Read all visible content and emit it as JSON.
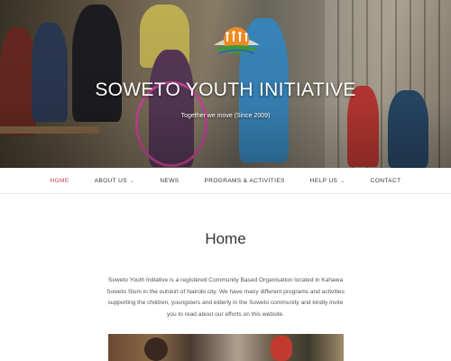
{
  "header": {
    "site_title": "SOWETO YOUTH INITIATIVE",
    "tagline": "Together we move (Since 2009)",
    "logo_icon": "soweto-youth-logo-icon"
  },
  "nav": {
    "items": [
      {
        "label": "HOME",
        "active": true,
        "has_dropdown": false
      },
      {
        "label": "ABOUT US",
        "active": false,
        "has_dropdown": true
      },
      {
        "label": "NEWS",
        "active": false,
        "has_dropdown": false
      },
      {
        "label": "PROGRAMS & ACTIVITIES",
        "active": false,
        "has_dropdown": false
      },
      {
        "label": "HELP US",
        "active": false,
        "has_dropdown": true
      },
      {
        "label": "CONTACT",
        "active": false,
        "has_dropdown": false
      }
    ],
    "dropdown_icon": "chevron-down-icon",
    "active_color": "#d23b3b"
  },
  "main": {
    "page_title": "Home",
    "intro": "Soweto Youth Initiative is a registered Community Based Organisation located in Kahawa Soweto Slum in the outskirt of Nairobi city. We have many different programs and activities supporting the children, youngsters and elderly in the Soweto community and kindly invite you to read about our efforts on this website."
  }
}
